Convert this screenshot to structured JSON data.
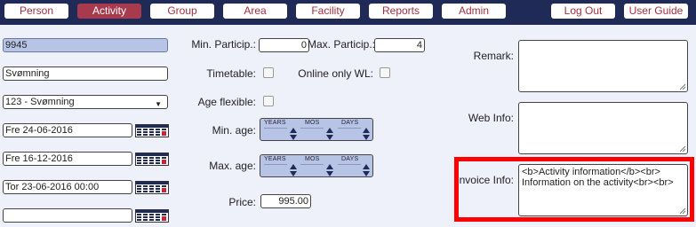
{
  "nav": {
    "person": "Person",
    "activity": "Activity",
    "group": "Group",
    "area": "Area",
    "facility": "Facility",
    "reports": "Reports",
    "admin": "Admin",
    "logout": "Log Out",
    "user_guide": "User Guide"
  },
  "form": {
    "id_value": "9945",
    "name_value": "Svømning",
    "activity_type": "123 - Svømning",
    "date1": "Fre 24-06-2016",
    "date2": "Fre 16-12-2016",
    "date3": "Tor 23-06-2016 00:00",
    "date4": "",
    "min_particip_label": "Min. Particip.:",
    "min_particip_value": "0",
    "max_particip_label": "Max. Particip.:",
    "max_particip_value": "4",
    "timetable_label": "Timetable:",
    "online_wl_label": "Online only WL:",
    "age_flexible_label": "Age flexible:",
    "min_age_label": "Min. age:",
    "max_age_label": "Max. age:",
    "duration_years": "YEARS",
    "duration_mos": "MOS",
    "duration_days": "DAYS",
    "price_label": "Price:",
    "price_value": "995.00",
    "remark_label": "Remark:",
    "remark_value": "",
    "webinfo_label": "Web Info:",
    "webinfo_value": "",
    "invoice_label": "Invoice Info:",
    "invoice_line1": "<b>Activity information</b><br>",
    "invoice_line2": "Information on the activity<br><br>"
  },
  "colors": {
    "nav_bg": "#1f2a57",
    "active_tab": "#a83a4d",
    "content_bg": "#eef0fa",
    "readonly_field": "#b8c4e6",
    "highlight": "#ff0000"
  }
}
